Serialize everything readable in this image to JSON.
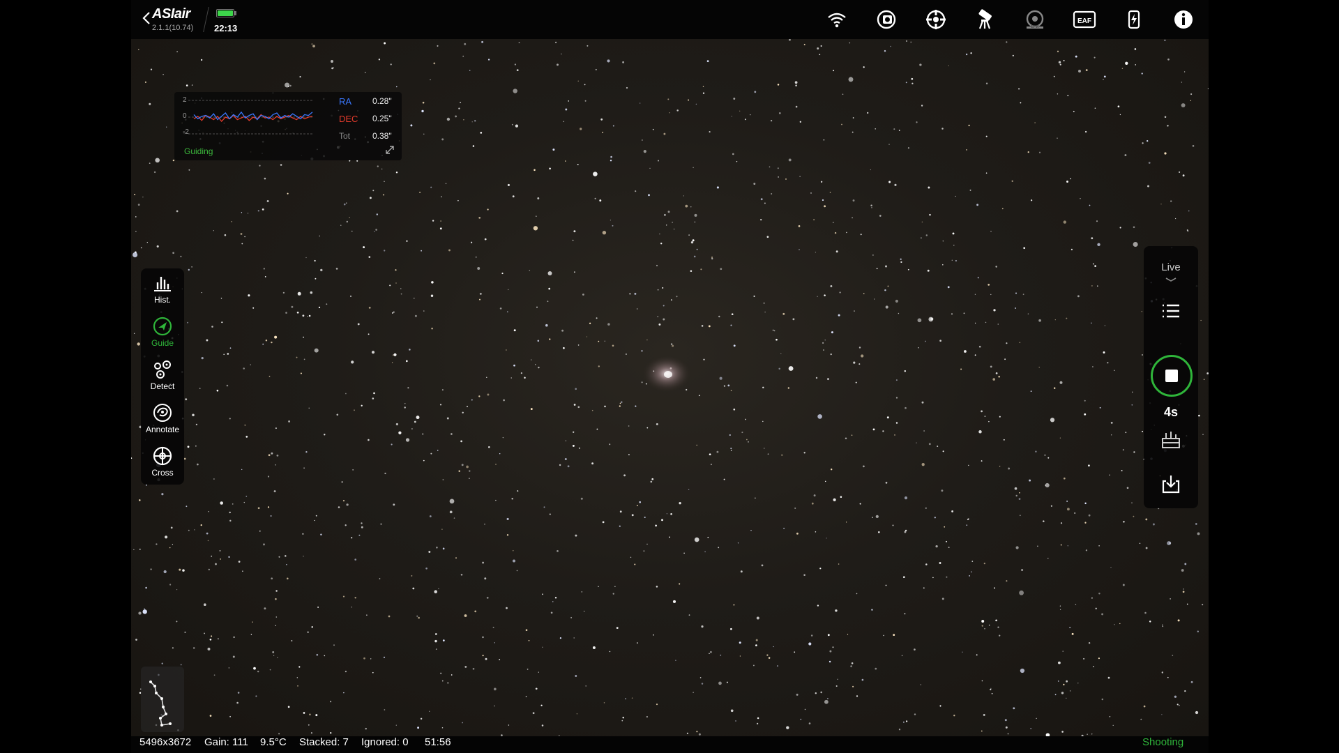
{
  "app": {
    "logo": "ASIair",
    "version": "2.1.1(10.74)",
    "time": "22:13",
    "battery_level": 1.0
  },
  "topbar_icons": [
    "wifi-icon",
    "camera-icon",
    "guide-scope-icon",
    "telescope-mount-icon",
    "filter-wheel-icon",
    "eaf-focuser-icon",
    "power-icon",
    "info-icon"
  ],
  "eaf_label": "EAF",
  "efw_label": "EFW",
  "guiding": {
    "y_ticks": [
      "2",
      "0",
      "-2"
    ],
    "ra": {
      "label": "RA",
      "value": "0.28\"",
      "color": "#3a78ff"
    },
    "dec": {
      "label": "DEC",
      "value": "0.25\"",
      "color": "#e53b2c"
    },
    "tot": {
      "label": "Tot",
      "value": "0.38\""
    },
    "status": "Guiding",
    "ra_series": [
      0.3,
      -0.2,
      0.1,
      0.2,
      -0.1,
      0.4,
      -0.3,
      0.1,
      0.5,
      -0.2,
      0.3,
      0.0,
      0.6,
      -0.1,
      0.2,
      0.4,
      -0.3,
      0.2,
      0.1,
      -0.2,
      0.3,
      0.5,
      -0.1,
      0.2,
      0.0,
      0.4,
      0.1,
      -0.2,
      0.3,
      0.2,
      0.6
    ],
    "dec_series": [
      -0.2,
      0.1,
      -0.4,
      0.2,
      0.0,
      -0.3,
      0.1,
      -0.5,
      0.0,
      -0.2,
      0.2,
      -0.3,
      -0.1,
      0.1,
      -0.4,
      0.0,
      -0.2,
      0.3,
      -0.1,
      0.0,
      -0.3,
      0.1,
      -0.2,
      0.0,
      0.2,
      -0.1,
      -0.3,
      0.1,
      -0.2,
      0.0,
      0.1
    ]
  },
  "left_tools": [
    {
      "name": "hist",
      "label": "Hist.",
      "active": false
    },
    {
      "name": "guide",
      "label": "Guide",
      "active": true
    },
    {
      "name": "detect",
      "label": "Detect",
      "active": false
    },
    {
      "name": "annotate",
      "label": "Annotate",
      "active": false
    },
    {
      "name": "cross",
      "label": "Cross",
      "active": false
    }
  ],
  "right_panel": {
    "mode": "Live",
    "exposure": "4s"
  },
  "status_bar": {
    "resolution": "5496x3672",
    "gain": "Gain: 111",
    "temperature": "9.5°C",
    "stacked": "Stacked: 7",
    "ignored": "Ignored: 0",
    "elapsed": "51:56",
    "state": "Shooting"
  },
  "colors": {
    "accent_green": "#2fb53a",
    "ra": "#3a78ff",
    "dec": "#e53b2c"
  }
}
